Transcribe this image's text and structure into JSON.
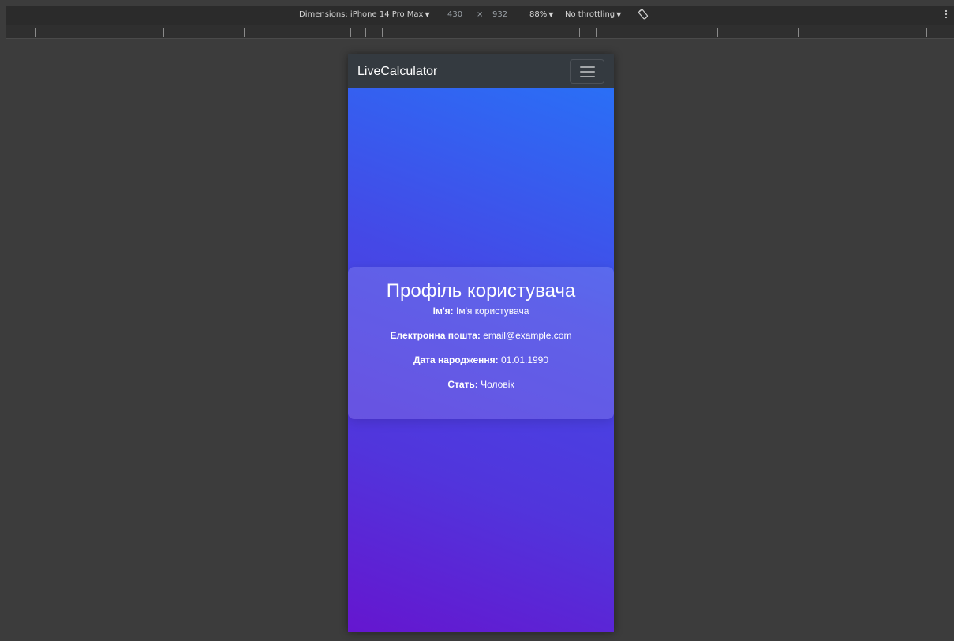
{
  "devtools": {
    "dimensions_label": "Dimensions: iPhone 14 Pro Max",
    "width": "430",
    "times": "×",
    "height": "932",
    "zoom": "88%",
    "throttling": "No throttling",
    "icons": [
      "caret-down-icon",
      "rotate-icon",
      "more-vertical-icon"
    ]
  },
  "app": {
    "brand": "LiveCalculator",
    "colors": {
      "navbar": "#343a40",
      "gradient_top": "#2a6ff6",
      "gradient_bottom": "#6516cf"
    }
  },
  "profile": {
    "title": "Профіль користувача",
    "fields": [
      {
        "label": "Ім'я:",
        "value": "Ім'я користувача"
      },
      {
        "label": "Електронна пошта:",
        "value": "email@example.com"
      },
      {
        "label": "Дата народження:",
        "value": "01.01.1990"
      },
      {
        "label": "Стать:",
        "value": "Чоловік"
      }
    ]
  }
}
